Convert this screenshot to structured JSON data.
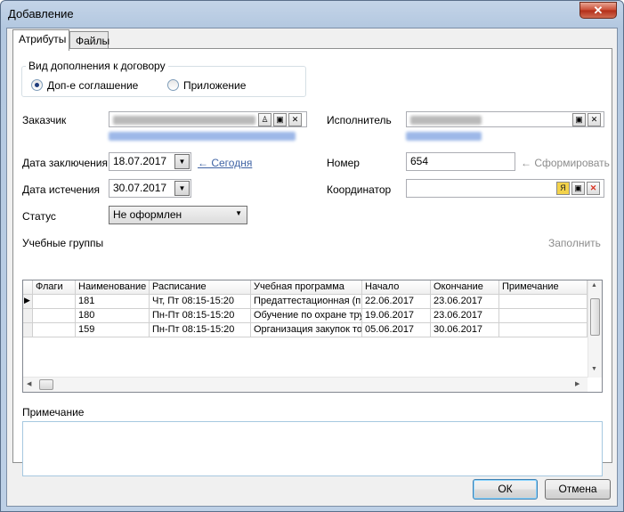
{
  "window": {
    "title": "Добавление",
    "close_glyph": "✕"
  },
  "tabs": [
    {
      "label": "Атрибуты"
    },
    {
      "label": "Файлы"
    }
  ],
  "supplement_type": {
    "title": "Вид дополнения к договору",
    "options": [
      {
        "label": "Доп-е соглашение",
        "selected": true
      },
      {
        "label": "Приложение",
        "selected": false
      }
    ]
  },
  "fields": {
    "customer_label": "Заказчик",
    "executor_label": "Исполнитель",
    "date_concluded_label": "Дата заключения",
    "date_concluded_value": "18.07.2017",
    "today_link": "← Сегодня",
    "number_label": "Номер",
    "number_value": "654",
    "generate_link": "← Сформировать",
    "date_expiry_label": "Дата истечения",
    "date_expiry_value": "30.07.2017",
    "coordinator_label": "Координатор",
    "status_label": "Статус",
    "status_value": "Не оформлен"
  },
  "groups": {
    "title": "Учебные группы",
    "fill_label": "Заполнить",
    "columns": [
      "Флаги",
      "Наименование",
      "Расписание",
      "Учебная программа",
      "Начало",
      "Окончание",
      "Примечание"
    ],
    "rows": [
      {
        "flags": "",
        "name": "181",
        "schedule": "Чт, Пт 08:15-15:20",
        "program": "Предаттестационная (пр",
        "start": "22.06.2017",
        "end": "23.06.2017",
        "note": ""
      },
      {
        "flags": "",
        "name": "180",
        "schedule": "Пн-Пт 08:15-15:20",
        "program": "Обучение по охране тру",
        "start": "19.06.2017",
        "end": "23.06.2017",
        "note": ""
      },
      {
        "flags": "",
        "name": "159",
        "schedule": "Пн-Пт 08:15-15:20",
        "program": "Организация закупок то",
        "start": "05.06.2017",
        "end": "30.06.2017",
        "note": ""
      }
    ]
  },
  "note": {
    "label": "Примечание",
    "value": ""
  },
  "buttons": {
    "ok": "ОК",
    "cancel": "Отмена"
  },
  "colors": {
    "accent_link": "#3f63a4",
    "clear_red": "#d9301f",
    "yandex_yellow": "#f3d24b"
  }
}
